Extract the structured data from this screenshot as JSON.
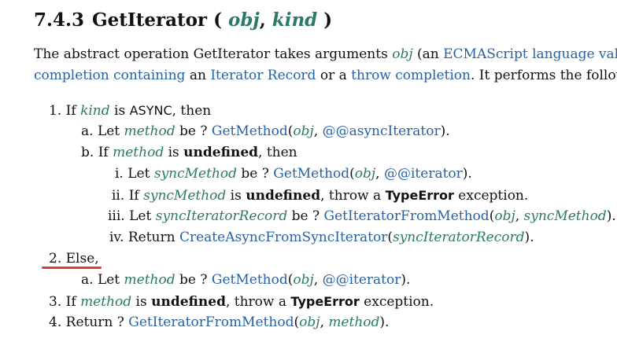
{
  "heading": {
    "number": "7.4.3",
    "name": "GetIterator",
    "open_paren": "(",
    "param1": "obj",
    "comma": ",",
    "param2": "kind",
    "close_paren": ")"
  },
  "intro": {
    "l1_a": "The abstract operation GetIterator takes arguments ",
    "l1_obj": "obj",
    "l1_b": " (an ",
    "l1_link": "ECMAScript language value",
    "l1_c": ")",
    "l2_link1": "completion containing",
    "l2_a": " an ",
    "l2_link2": "Iterator Record",
    "l2_b": " or a ",
    "l2_link3": "throw completion",
    "l2_c": ". It performs the followi"
  },
  "steps": {
    "s1": {
      "marker": "1.",
      "a": "If ",
      "var": "kind",
      "b": " is ",
      "code": "ASYNC",
      "c": ", then"
    },
    "s1a": {
      "marker": "a.",
      "a": "Let ",
      "var": "method",
      "b": " be ? ",
      "fn": "GetMethod",
      "p_open": "(",
      "arg1": "obj",
      "sep": ", ",
      "sym": "@@asyncIterator",
      "p_close": ")."
    },
    "s1b": {
      "marker": "b.",
      "a": "If ",
      "var": "method",
      "b": " is ",
      "bold": "undefined",
      "c": ", then"
    },
    "s1bi": {
      "marker": "i.",
      "a": "Let ",
      "var": "syncMethod",
      "b": " be ? ",
      "fn": "GetMethod",
      "p_open": "(",
      "arg1": "obj",
      "sep": ", ",
      "sym": "@@iterator",
      "p_close": ")."
    },
    "s1bii": {
      "marker": "ii.",
      "a": "If ",
      "var": "syncMethod",
      "b": " is ",
      "bold": "undefined",
      "c": ", throw a ",
      "err": "TypeError",
      "d": " exception."
    },
    "s1biii": {
      "marker": "iii.",
      "a": "Let ",
      "var": "syncIteratorRecord",
      "b": " be ? ",
      "fn": "GetIteratorFromMethod",
      "p_open": "(",
      "arg1": "obj",
      "sep": ", ",
      "arg2": "syncMethod",
      "p_close": ")."
    },
    "s1biv": {
      "marker": "iv.",
      "a": "Return ",
      "fn": "CreateAsyncFromSyncIterator",
      "p_open": "(",
      "arg1": "syncIteratorRecord",
      "p_close": ")."
    },
    "s2": {
      "marker": "2.",
      "a": "Else,"
    },
    "s2a": {
      "marker": "a.",
      "a": "Let ",
      "var": "method",
      "b": " be ? ",
      "fn": "GetMethod",
      "p_open": "(",
      "arg1": "obj",
      "sep": ", ",
      "sym": "@@iterator",
      "p_close": ")."
    },
    "s3": {
      "marker": "3.",
      "a": "If ",
      "var": "method",
      "b": " is ",
      "bold": "undefined",
      "c": ", throw a ",
      "err": "TypeError",
      "d": " exception."
    },
    "s4": {
      "marker": "4.",
      "a": "Return ? ",
      "fn": "GetIteratorFromMethod",
      "p_open": "(",
      "arg1": "obj",
      "sep": ", ",
      "arg2": "method",
      "p_close": ")."
    }
  },
  "colors": {
    "variable": "#2b7a68",
    "link": "#2762a4",
    "highlight_underline": "#e03a3a"
  }
}
